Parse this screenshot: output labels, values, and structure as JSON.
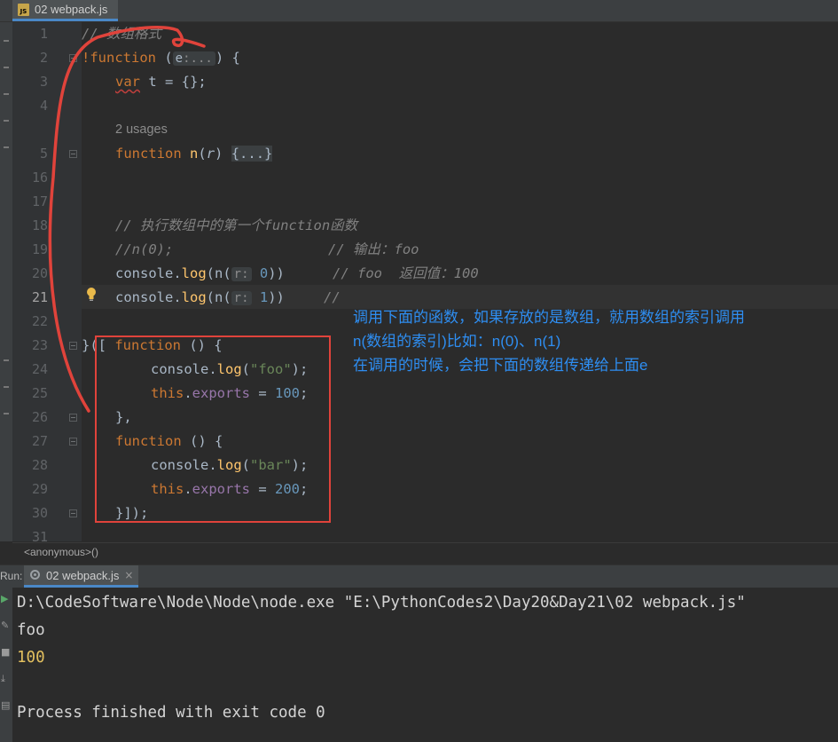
{
  "editor_tab": {
    "badge": "JS",
    "filename": "02 webpack.js"
  },
  "gutter": {
    "line_numbers": [
      "1",
      "2",
      "3",
      "4",
      "5",
      "16",
      "17",
      "18",
      "19",
      "20",
      "21",
      "22",
      "23",
      "24",
      "25",
      "26",
      "27",
      "28",
      "29",
      "30",
      "31"
    ],
    "current_line": "21"
  },
  "code": {
    "l1": "// 数组格式",
    "l2_bang": "!",
    "l2_kw": "function",
    "l2_open": " (",
    "l2_hint": "e",
    "l2_hint_more": ":...",
    "l2_close": ") {",
    "l3_kw": "var",
    "l3_rest": " t = {};",
    "usages": "2 usages",
    "l5_kw": "function",
    "l5_sp": " ",
    "l5_name": "n",
    "l5_open": "(",
    "l5_param": "r",
    "l5_close": ") ",
    "l5_fold": "{...}",
    "l18": "// 执行数组中的第一个function函数",
    "l19_code": "//n(0);",
    "l19_cm": "// 输出：foo",
    "l20_a": "console.",
    "l20_log": "log",
    "l20_b": "(n(",
    "l20_hint": "r:",
    "l20_num": " 0",
    "l20_c": "))",
    "l20_cm": "// foo  返回值：100",
    "l21_a": "console.",
    "l21_log": "log",
    "l21_b": "(n(",
    "l21_hint": "r:",
    "l21_num": " 1",
    "l21_c": "))",
    "l21_cm": "//",
    "l23_a": "}([ ",
    "l23_kw": "function",
    "l23_b": " () {",
    "l24_a": "console.",
    "l24_log": "log",
    "l24_b": "(",
    "l24_str": "\"foo\"",
    "l24_c": ");",
    "l25_kw": "this",
    "l25_a": ".",
    "l25_ex": "exports",
    "l25_b": " = ",
    "l25_num": "100",
    "l25_c": ";",
    "l26": "},",
    "l27_kw": "function",
    "l27_b": " () {",
    "l28_a": "console.",
    "l28_log": "log",
    "l28_b": "(",
    "l28_str": "\"bar\"",
    "l28_c": ");",
    "l29_kw": "this",
    "l29_a": ".",
    "l29_ex": "exports",
    "l29_b": " = ",
    "l29_num": "200",
    "l29_c": ";",
    "l30": "}]);"
  },
  "annotation": {
    "line1": "调用下面的函数，如果存放的是数组，就用数组的索引调用",
    "line2": "n(数组的索引)比如：n(0)、n(1)",
    "line3": "在调用的时候，会把下面的数组传递给上面e"
  },
  "breadcrumb": "<anonymous>()",
  "run_panel": {
    "label": "Run:",
    "tab": "02 webpack.js",
    "close": "×",
    "command": "D:\\CodeSoftware\\Node\\Node\\node.exe \"E:\\PythonCodes2\\Day20&Day21\\02 webpack.js\"",
    "out1": "foo",
    "out2": "100",
    "finished": "Process finished with exit code 0"
  },
  "colors": {
    "keyword": "#cc7832",
    "function_name": "#ffc66d",
    "string": "#6a8759",
    "number": "#6897bb",
    "comment": "#808080",
    "annotation_text": "#2e8ef2",
    "annotation_box": "#e0433b"
  },
  "icons": [
    "js-file-icon",
    "bulb-icon",
    "run-icon",
    "wrench-icon",
    "scroll-down-icon",
    "fold-marker-icon"
  ]
}
